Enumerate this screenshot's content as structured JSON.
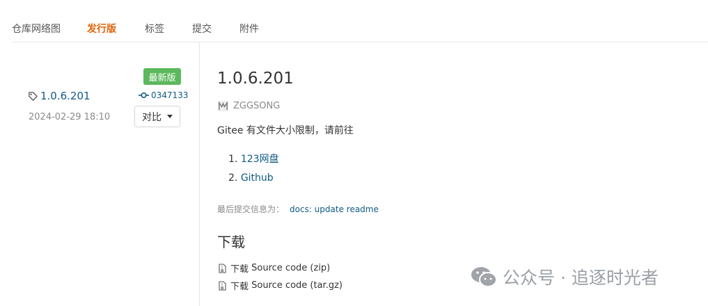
{
  "tabs": [
    {
      "label": "仓库网络图",
      "active": false
    },
    {
      "label": "发行版",
      "active": true
    },
    {
      "label": "标签",
      "active": false
    },
    {
      "label": "提交",
      "active": false
    },
    {
      "label": "附件",
      "active": false
    }
  ],
  "sidebar": {
    "tag": "1.0.6.201",
    "date": "2024-02-29 18:10",
    "latest_badge": "最新版",
    "commit_hash": "0347133",
    "compare_label": "对比"
  },
  "release": {
    "title": "1.0.6.201",
    "author": "ZGGSONG",
    "description": "Gitee 有文件大小限制，请前往",
    "links": [
      {
        "num": "1.",
        "label": "123网盘"
      },
      {
        "num": "2.",
        "label": "Github"
      }
    ],
    "last_commit_label": "最后提交信息为：",
    "last_commit_message": "docs: update readme",
    "download_title": "下载",
    "downloads": [
      {
        "prefix": "下载",
        "label": "Source code (zip)"
      },
      {
        "prefix": "下载",
        "label": "Source code (tar.gz)"
      }
    ]
  },
  "watermark": {
    "text": "公众号 · 追逐时光者"
  },
  "colors": {
    "accent": "#e36209",
    "link": "#0f5a86",
    "badge": "#5cb85c",
    "muted": "#8a8a8a"
  }
}
